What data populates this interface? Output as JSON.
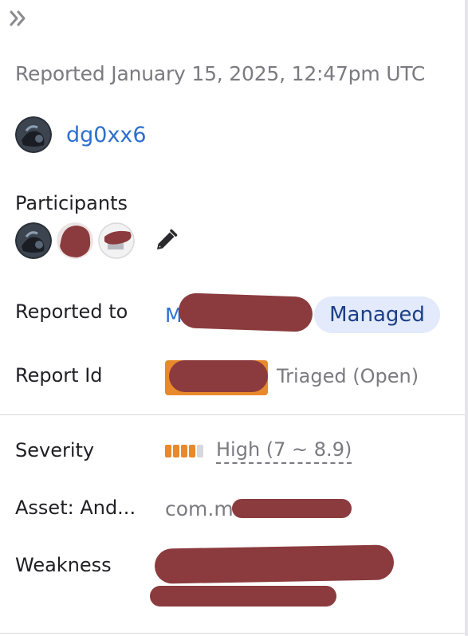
{
  "panel": {
    "collapse_label": "»",
    "reported_date": "Reported January 15, 2025, 12:47pm UTC"
  },
  "reporter": {
    "username": "dg0xx6"
  },
  "participants": {
    "label": "Participants",
    "count_avatars": 3
  },
  "details": {
    "reported_to_label": "Reported to",
    "reported_to_value_visible": "M",
    "managed_badge": "Managed",
    "report_id_label": "Report Id",
    "report_status": "Triaged (Open)",
    "severity_label": "Severity",
    "severity_value": "High (7 ~ 8.9)",
    "severity_level": 4,
    "severity_max": 5,
    "asset_label": "Asset: And...",
    "asset_value_visible": "com.m",
    "weakness_label": "Weakness"
  },
  "colors": {
    "link_blue": "#2d6fd0",
    "badge_bg": "#e2eafb",
    "badge_text": "#1c3f86",
    "severity_high": "#e8892c",
    "severity_empty": "#d5d8dd",
    "report_id_bg": "#e8892c",
    "redaction": "#8b3b3d"
  }
}
